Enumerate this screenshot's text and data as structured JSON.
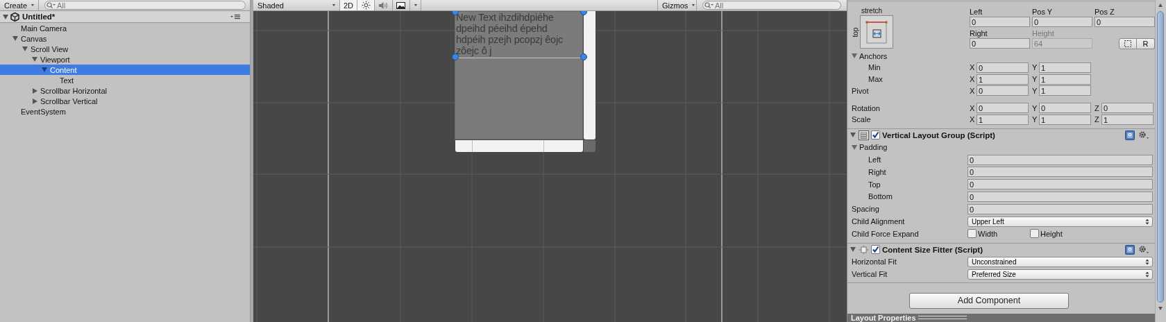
{
  "hierarchy": {
    "create_label": "Create",
    "search_placeholder": "All",
    "scene": {
      "title": "Untitled*",
      "expanded": true
    },
    "items": [
      {
        "label": "Main Camera",
        "selected": false
      },
      {
        "label": "Canvas",
        "selected": false,
        "expanded": true,
        "children": [
          {
            "label": "Scroll View",
            "selected": false,
            "expanded": true,
            "children": [
              {
                "label": "Viewport",
                "selected": false,
                "expanded": true,
                "children": [
                  {
                    "label": "Content",
                    "selected": true,
                    "expanded": true,
                    "children": [
                      {
                        "label": "Text",
                        "selected": false
                      }
                    ]
                  }
                ]
              },
              {
                "label": "Scrollbar Horizontal",
                "selected": false,
                "expanded": false
              },
              {
                "label": "Scrollbar Vertical",
                "selected": false,
                "expanded": false
              }
            ]
          }
        ]
      },
      {
        "label": "EventSystem",
        "selected": false
      }
    ]
  },
  "scene_view": {
    "draw_mode": "Shaded",
    "toggles": [
      {
        "kind": "text",
        "label": "2D",
        "on": true
      },
      {
        "kind": "light",
        "on": true
      },
      {
        "kind": "audio",
        "on": false
      },
      {
        "kind": "effects",
        "on": false
      }
    ],
    "gizmos_label": "Gizmos",
    "search_placeholder": "All",
    "text_lines": [
      "New Text ihzdihdpiéhe",
      "dpeihd péeihd épehd",
      "hdpéih pzejh pcopzj êojc",
      "zôejc ô j"
    ]
  },
  "inspector": {
    "rect_transform": {
      "preset_top": "stretch",
      "preset_side": "top",
      "fields": [
        {
          "label": "Left",
          "value": "0",
          "disabled": false
        },
        {
          "label": "Pos Y",
          "value": "0",
          "disabled": false
        },
        {
          "label": "Pos Z",
          "value": "0",
          "disabled": false
        },
        {
          "label": "Right",
          "value": "0",
          "disabled": false
        },
        {
          "label": "Height",
          "value": "64",
          "disabled": true
        }
      ],
      "reset_label": "R",
      "anchors": {
        "label": "Anchors",
        "expanded": true,
        "rows": [
          {
            "label": "Min",
            "values": [
              {
                "axis": "X",
                "value": "0"
              },
              {
                "axis": "Y",
                "value": "1"
              }
            ]
          },
          {
            "label": "Max",
            "values": [
              {
                "axis": "X",
                "value": "1"
              },
              {
                "axis": "Y",
                "value": "1"
              }
            ]
          }
        ]
      },
      "pivot": {
        "label": "Pivot",
        "values": [
          {
            "axis": "X",
            "value": "0"
          },
          {
            "axis": "Y",
            "value": "1"
          }
        ]
      },
      "transform_rows": [
        {
          "label": "Rotation",
          "values": [
            {
              "axis": "X",
              "value": "0"
            },
            {
              "axis": "Y",
              "value": "0"
            },
            {
              "axis": "Z",
              "value": "0"
            }
          ]
        },
        {
          "label": "Scale",
          "values": [
            {
              "axis": "X",
              "value": "1"
            },
            {
              "axis": "Y",
              "value": "1"
            },
            {
              "axis": "Z",
              "value": "1"
            }
          ]
        }
      ]
    },
    "components": [
      {
        "kind": "vertical-layout",
        "title": "Vertical Layout Group (Script)",
        "enabled": true,
        "expanded": true,
        "rows": [
          {
            "kind": "group",
            "label": "Padding",
            "expanded": true,
            "children": [
              {
                "kind": "field",
                "label": "Left",
                "value": "0"
              },
              {
                "kind": "field",
                "label": "Right",
                "value": "0"
              },
              {
                "kind": "field",
                "label": "Top",
                "value": "0"
              },
              {
                "kind": "field",
                "label": "Bottom",
                "value": "0"
              }
            ]
          },
          {
            "kind": "field",
            "label": "Spacing",
            "value": "0"
          },
          {
            "kind": "dropdown",
            "label": "Child Alignment",
            "value": "Upper Left"
          },
          {
            "kind": "checks",
            "label": "Child Force Expand",
            "options": [
              {
                "label": "Width",
                "checked": false
              },
              {
                "label": "Height",
                "checked": false
              }
            ]
          }
        ]
      },
      {
        "kind": "size-fitter",
        "title": "Content Size Fitter (Script)",
        "enabled": true,
        "expanded": true,
        "rows": [
          {
            "kind": "dropdown",
            "label": "Horizontal Fit",
            "value": "Unconstrained"
          },
          {
            "kind": "dropdown",
            "label": "Vertical Fit",
            "value": "Preferred Size"
          }
        ]
      }
    ],
    "add_component_label": "Add Component",
    "footer": "Layout Properties"
  }
}
